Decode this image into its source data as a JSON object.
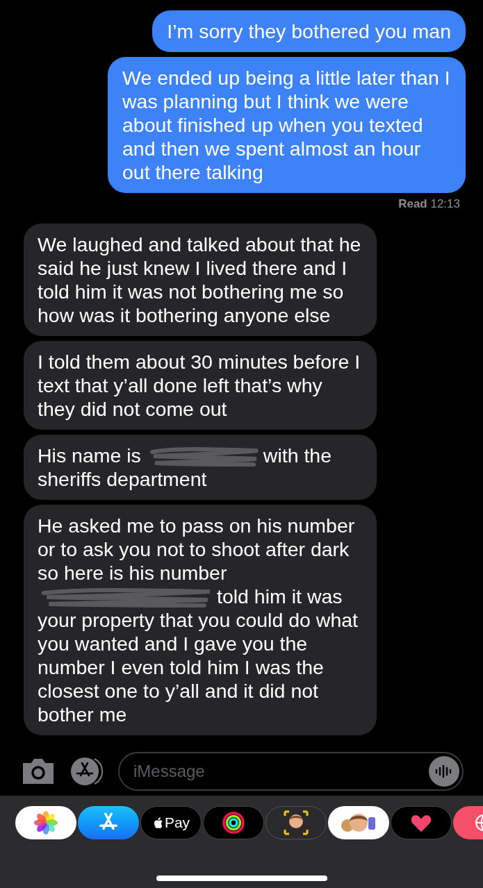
{
  "messages": [
    {
      "kind": "sent",
      "parts": [
        {
          "kind": "text",
          "text": "I’m sorry they bothered you man"
        }
      ]
    },
    {
      "kind": "sent",
      "parts": [
        {
          "kind": "text",
          "text": "We ended up being a little later than I was planning but I think we were about finished up when you texted and then we spent almost an hour out there talking"
        }
      ]
    },
    {
      "kind": "receipt",
      "text": "**Read** 12:13"
    },
    {
      "kind": "received",
      "parts": [
        {
          "kind": "text",
          "text": "We laughed and talked about that he said he just knew I lived there and I told him it was not bothering me so how was it bothering anyone else"
        }
      ]
    },
    {
      "kind": "received",
      "parts": [
        {
          "kind": "text",
          "text": "I told them about 30 minutes before I text that y’all done left that’s why they did not come out"
        }
      ]
    },
    {
      "kind": "received",
      "parts": [
        {
          "kind": "text",
          "text": "His name is"
        },
        {
          "kind": "redaction"
        },
        {
          "kind": "text",
          "text": "with the sheriffs department"
        }
      ]
    },
    {
      "kind": "received",
      "parts": [
        {
          "kind": "text",
          "text": "He asked me to pass on his number or  to ask you not to shoot after dark so here is his number"
        },
        {
          "kind": "break"
        },
        {
          "kind": "redaction"
        },
        {
          "kind": "text",
          "text": "told him it was your property that you could do what you wanted and I gave you the number  I even told him I was the closest one to y’all and it did not bother me"
        }
      ]
    }
  ],
  "compose": {
    "placeholder": "iMessage"
  },
  "apps": [
    {
      "kind": "photos"
    },
    {
      "kind": "appstore"
    },
    {
      "kind": "pay",
      "label": "Pay"
    },
    {
      "kind": "activity"
    },
    {
      "kind": "memoji"
    },
    {
      "kind": "stickers"
    },
    {
      "kind": "touch"
    },
    {
      "kind": "web"
    }
  ]
}
